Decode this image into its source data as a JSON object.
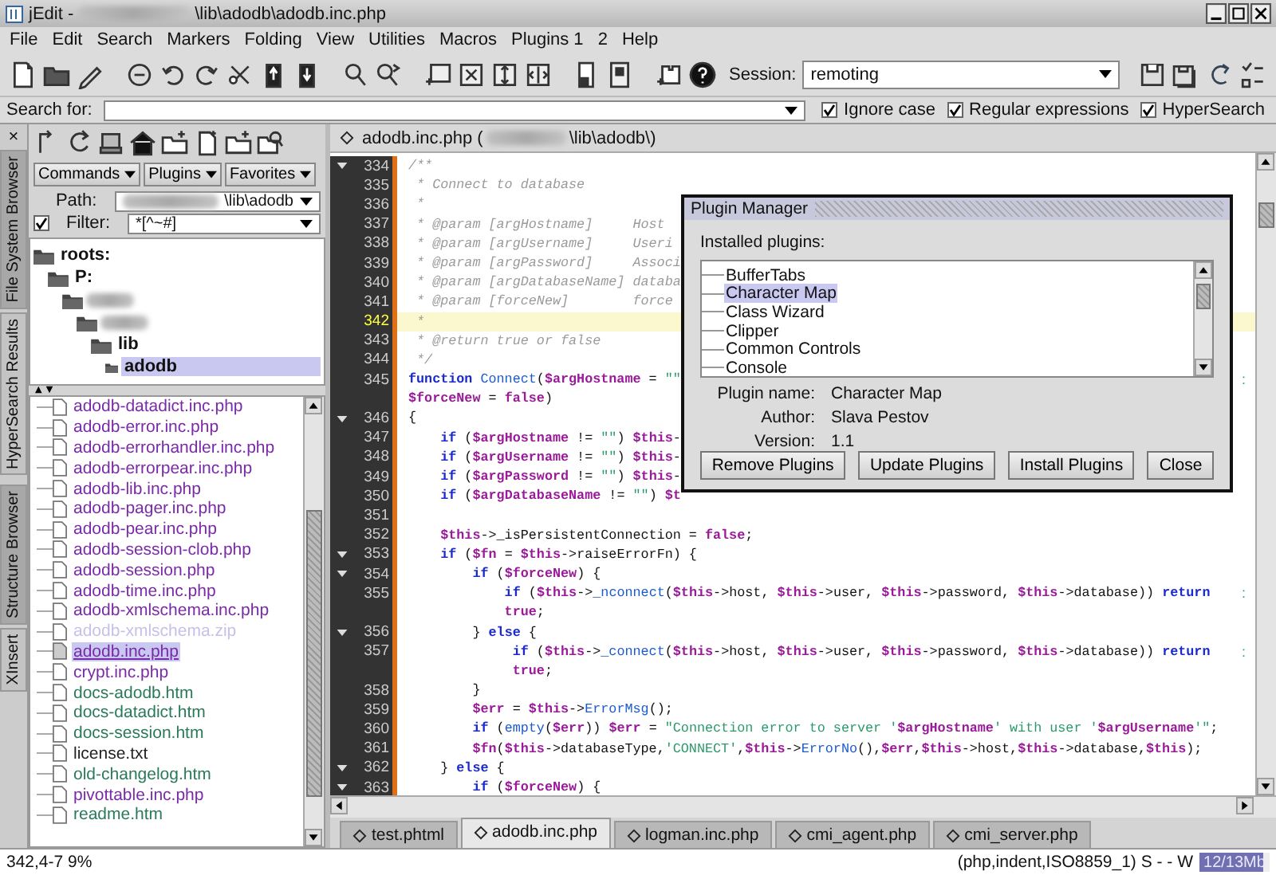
{
  "window": {
    "title_prefix": "jEdit -",
    "title_path": "\\lib\\adodb\\adodb.inc.php"
  },
  "menu": [
    "File",
    "Edit",
    "Search",
    "Markers",
    "Folding",
    "View",
    "Utilities",
    "Macros",
    "Plugins 1",
    "2",
    "Help"
  ],
  "session": {
    "label": "Session:",
    "value": "remoting"
  },
  "search_bar": {
    "label": "Search for:",
    "options": [
      {
        "label": "Ignore case",
        "checked": true
      },
      {
        "label": "Regular expressions",
        "checked": true
      },
      {
        "label": "HyperSearch",
        "checked": true
      }
    ]
  },
  "dock": {
    "close": "×",
    "tabs_top": [
      {
        "label": "File System Browser",
        "selected": true
      },
      {
        "label": "HyperSearch Results",
        "selected": false
      }
    ],
    "tabs_bottom": [
      {
        "label": "Structure Browser",
        "selected": true
      },
      {
        "label": "XInsert",
        "selected": false
      }
    ]
  },
  "browser": {
    "buttons": [
      "Commands",
      "Plugins",
      "Favorites"
    ],
    "path": {
      "label": "Path:",
      "value": "\\lib\\adodb"
    },
    "filter": {
      "label": "Filter:",
      "checked": true,
      "value": "*[^~#]"
    },
    "tree": [
      {
        "label": "roots:",
        "selected": false,
        "children": [
          {
            "label": "P:",
            "selected": false,
            "children": [
              {
                "redacted": true,
                "selected": false,
                "children": [
                  {
                    "redacted": true,
                    "selected": false,
                    "children": [
                      {
                        "label": "lib",
                        "selected": false,
                        "children": [
                          {
                            "label": "adodb",
                            "selected": true
                          }
                        ]
                      }
                    ]
                  }
                ]
              }
            ]
          }
        ]
      }
    ],
    "files": [
      {
        "name": "adodb-datadict.inc.php",
        "color": "#7a2aa8",
        "selected": false
      },
      {
        "name": "adodb-error.inc.php",
        "color": "#7a2aa8",
        "selected": false
      },
      {
        "name": "adodb-errorhandler.inc.php",
        "color": "#7a2aa8",
        "selected": false
      },
      {
        "name": "adodb-errorpear.inc.php",
        "color": "#7a2aa8",
        "selected": false
      },
      {
        "name": "adodb-lib.inc.php",
        "color": "#7a2aa8",
        "selected": false
      },
      {
        "name": "adodb-pager.inc.php",
        "color": "#7a2aa8",
        "selected": false
      },
      {
        "name": "adodb-pear.inc.php",
        "color": "#7a2aa8",
        "selected": false
      },
      {
        "name": "adodb-session-clob.php",
        "color": "#7a2aa8",
        "selected": false
      },
      {
        "name": "adodb-session.php",
        "color": "#7a2aa8",
        "selected": false
      },
      {
        "name": "adodb-time.inc.php",
        "color": "#7a2aa8",
        "selected": false
      },
      {
        "name": "adodb-xmlschema.inc.php",
        "color": "#7a2aa8",
        "selected": false
      },
      {
        "name": "adodb-xmlschema.zip",
        "color": "#c8c0e8",
        "selected": false
      },
      {
        "name": "adodb.inc.php",
        "color": "#7a2aa8",
        "selected": true
      },
      {
        "name": "crypt.inc.php",
        "color": "#7a2aa8",
        "selected": false
      },
      {
        "name": "docs-adodb.htm",
        "color": "#2a7a5a",
        "selected": false
      },
      {
        "name": "docs-datadict.htm",
        "color": "#2a7a5a",
        "selected": false
      },
      {
        "name": "docs-session.htm",
        "color": "#2a7a5a",
        "selected": false
      },
      {
        "name": "license.txt",
        "color": "#222222",
        "selected": false
      },
      {
        "name": "old-changelog.htm",
        "color": "#2a7a5a",
        "selected": false
      },
      {
        "name": "pivottable.inc.php",
        "color": "#7a2aa8",
        "selected": false
      },
      {
        "name": "readme.htm",
        "color": "#2a7a5a",
        "selected": false
      }
    ]
  },
  "editor": {
    "header_file": "adodb.inc.php (",
    "header_path": "\\lib\\adodb\\)",
    "lines": [
      {
        "number": "334",
        "fold": true,
        "current": false,
        "segments": [
          {
            "kind": "com",
            "text": "/**"
          }
        ]
      },
      {
        "number": "335",
        "fold": false,
        "current": false,
        "segments": [
          {
            "kind": "com",
            "text": " * Connect to database"
          }
        ]
      },
      {
        "number": "336",
        "fold": false,
        "current": false,
        "segments": [
          {
            "kind": "com",
            "text": " *"
          }
        ]
      },
      {
        "number": "337",
        "fold": false,
        "current": false,
        "segments": [
          {
            "kind": "com",
            "text": " * @param [argHostname]     Host"
          }
        ]
      },
      {
        "number": "338",
        "fold": false,
        "current": false,
        "segments": [
          {
            "kind": "com",
            "text": " * @param [argUsername]     Useri"
          }
        ]
      },
      {
        "number": "339",
        "fold": false,
        "current": false,
        "segments": [
          {
            "kind": "com",
            "text": " * @param [argPassword]     Associ"
          }
        ]
      },
      {
        "number": "340",
        "fold": false,
        "current": false,
        "segments": [
          {
            "kind": "com",
            "text": " * @param [argDatabaseName] databa"
          }
        ]
      },
      {
        "number": "341",
        "fold": false,
        "current": false,
        "segments": [
          {
            "kind": "com",
            "text": " * @param [forceNew]        force"
          }
        ]
      },
      {
        "number": "342",
        "fold": false,
        "current": true,
        "segments": [
          {
            "kind": "com",
            "text": " *"
          }
        ]
      },
      {
        "number": "343",
        "fold": false,
        "current": false,
        "segments": [
          {
            "kind": "com",
            "text": " * @return true or false"
          }
        ]
      },
      {
        "number": "344",
        "fold": false,
        "current": false,
        "segments": [
          {
            "kind": "com",
            "text": " */"
          }
        ]
      },
      {
        "number": "345",
        "fold": false,
        "current": false,
        "wrap_mark": ":",
        "segments": [
          {
            "kind": "kw",
            "text": "function "
          },
          {
            "kind": "fn",
            "text": "Connect"
          },
          {
            "kind": "txt",
            "text": "("
          },
          {
            "kind": "var",
            "text": "$argHostname"
          },
          {
            "kind": "txt",
            "text": " = "
          },
          {
            "kind": "str",
            "text": "\"\""
          }
        ]
      },
      {
        "fold": false,
        "current": false,
        "segments": [
          {
            "kind": "var",
            "text": "$forceNew"
          },
          {
            "kind": "txt",
            "text": " = "
          },
          {
            "kind": "lit",
            "text": "false"
          },
          {
            "kind": "txt",
            "text": ")"
          }
        ]
      },
      {
        "number": "346",
        "fold": true,
        "current": false,
        "segments": [
          {
            "kind": "txt",
            "text": "{"
          }
        ]
      },
      {
        "number": "347",
        "fold": false,
        "current": false,
        "segments": [
          {
            "kind": "kw",
            "text": "    if"
          },
          {
            "kind": "txt",
            "text": " ("
          },
          {
            "kind": "var",
            "text": "$argHostname"
          },
          {
            "kind": "txt",
            "text": " != "
          },
          {
            "kind": "str",
            "text": "\"\""
          },
          {
            "kind": "txt",
            "text": ") "
          },
          {
            "kind": "var",
            "text": "$this"
          },
          {
            "kind": "txt",
            "text": "-"
          }
        ]
      },
      {
        "number": "348",
        "fold": false,
        "current": false,
        "segments": [
          {
            "kind": "kw",
            "text": "    if"
          },
          {
            "kind": "txt",
            "text": " ("
          },
          {
            "kind": "var",
            "text": "$argUsername"
          },
          {
            "kind": "txt",
            "text": " != "
          },
          {
            "kind": "str",
            "text": "\"\""
          },
          {
            "kind": "txt",
            "text": ") "
          },
          {
            "kind": "var",
            "text": "$this"
          },
          {
            "kind": "txt",
            "text": "-"
          }
        ]
      },
      {
        "number": "349",
        "fold": false,
        "current": false,
        "segments": [
          {
            "kind": "kw",
            "text": "    if"
          },
          {
            "kind": "txt",
            "text": " ("
          },
          {
            "kind": "var",
            "text": "$argPassword"
          },
          {
            "kind": "txt",
            "text": " != "
          },
          {
            "kind": "str",
            "text": "\"\""
          },
          {
            "kind": "txt",
            "text": ") "
          },
          {
            "kind": "var",
            "text": "$this"
          },
          {
            "kind": "txt",
            "text": "-"
          }
        ]
      },
      {
        "number": "350",
        "fold": false,
        "current": false,
        "segments": [
          {
            "kind": "kw",
            "text": "    if"
          },
          {
            "kind": "txt",
            "text": " ("
          },
          {
            "kind": "var",
            "text": "$argDatabaseName"
          },
          {
            "kind": "txt",
            "text": " != "
          },
          {
            "kind": "str",
            "text": "\"\""
          },
          {
            "kind": "txt",
            "text": ") "
          },
          {
            "kind": "var",
            "text": "$t"
          }
        ]
      },
      {
        "number": "351",
        "fold": false,
        "current": false
      },
      {
        "number": "352",
        "fold": false,
        "current": false,
        "segments": [
          {
            "kind": "var",
            "text": "    $this"
          },
          {
            "kind": "txt",
            "text": "->_isPersistentConnection = "
          },
          {
            "kind": "lit",
            "text": "false"
          },
          {
            "kind": "txt",
            "text": ";"
          }
        ]
      },
      {
        "number": "353",
        "fold": true,
        "current": false,
        "segments": [
          {
            "kind": "kw",
            "text": "    if"
          },
          {
            "kind": "txt",
            "text": " ("
          },
          {
            "kind": "var",
            "text": "$fn"
          },
          {
            "kind": "txt",
            "text": " = "
          },
          {
            "kind": "var",
            "text": "$this"
          },
          {
            "kind": "txt",
            "text": "->raiseErrorFn) {"
          }
        ]
      },
      {
        "number": "354",
        "fold": true,
        "current": false,
        "segments": [
          {
            "kind": "kw",
            "text": "        if"
          },
          {
            "kind": "txt",
            "text": " ("
          },
          {
            "kind": "var",
            "text": "$forceNew"
          },
          {
            "kind": "txt",
            "text": ") {"
          }
        ]
      },
      {
        "number": "355",
        "fold": false,
        "current": false,
        "wrap_mark": ":",
        "segments": [
          {
            "kind": "kw",
            "text": "            if"
          },
          {
            "kind": "txt",
            "text": " ("
          },
          {
            "kind": "var",
            "text": "$this"
          },
          {
            "kind": "txt",
            "text": "->"
          },
          {
            "kind": "fn",
            "text": "_nconnect"
          },
          {
            "kind": "txt",
            "text": "("
          },
          {
            "kind": "var",
            "text": "$this"
          },
          {
            "kind": "txt",
            "text": "->host, "
          },
          {
            "kind": "var",
            "text": "$this"
          },
          {
            "kind": "txt",
            "text": "->user, "
          },
          {
            "kind": "var",
            "text": "$this"
          },
          {
            "kind": "txt",
            "text": "->password, "
          },
          {
            "kind": "var",
            "text": "$this"
          },
          {
            "kind": "txt",
            "text": "->database)) "
          },
          {
            "kind": "kw",
            "text": "return"
          }
        ]
      },
      {
        "fold": false,
        "current": false,
        "segments": [
          {
            "kind": "lit",
            "text": "            true"
          },
          {
            "kind": "txt",
            "text": ";"
          }
        ]
      },
      {
        "number": "356",
        "fold": true,
        "current": false,
        "segments": [
          {
            "kind": "txt",
            "text": "        } "
          },
          {
            "kind": "kw",
            "text": "else"
          },
          {
            "kind": "txt",
            "text": " {"
          }
        ]
      },
      {
        "number": "357",
        "fold": false,
        "current": false,
        "wrap_mark": ":",
        "segments": [
          {
            "kind": "kw",
            "text": "             if"
          },
          {
            "kind": "txt",
            "text": " ("
          },
          {
            "kind": "var",
            "text": "$this"
          },
          {
            "kind": "txt",
            "text": "->"
          },
          {
            "kind": "fn",
            "text": "_connect"
          },
          {
            "kind": "txt",
            "text": "("
          },
          {
            "kind": "var",
            "text": "$this"
          },
          {
            "kind": "txt",
            "text": "->host, "
          },
          {
            "kind": "var",
            "text": "$this"
          },
          {
            "kind": "txt",
            "text": "->user, "
          },
          {
            "kind": "var",
            "text": "$this"
          },
          {
            "kind": "txt",
            "text": "->password, "
          },
          {
            "kind": "var",
            "text": "$this"
          },
          {
            "kind": "txt",
            "text": "->database)) "
          },
          {
            "kind": "kw",
            "text": "return"
          }
        ]
      },
      {
        "fold": false,
        "current": false,
        "segments": [
          {
            "kind": "lit",
            "text": "             true"
          },
          {
            "kind": "txt",
            "text": ";"
          }
        ]
      },
      {
        "number": "358",
        "fold": false,
        "current": false,
        "segments": [
          {
            "kind": "txt",
            "text": "        }"
          }
        ]
      },
      {
        "number": "359",
        "fold": false,
        "current": false,
        "segments": [
          {
            "kind": "var",
            "text": "        $err"
          },
          {
            "kind": "txt",
            "text": " = "
          },
          {
            "kind": "var",
            "text": "$this"
          },
          {
            "kind": "txt",
            "text": "->"
          },
          {
            "kind": "fn",
            "text": "ErrorMsg"
          },
          {
            "kind": "txt",
            "text": "();"
          }
        ]
      },
      {
        "number": "360",
        "fold": false,
        "current": false,
        "segments": [
          {
            "kind": "kw",
            "text": "        if"
          },
          {
            "kind": "txt",
            "text": " ("
          },
          {
            "kind": "fn",
            "text": "empty"
          },
          {
            "kind": "txt",
            "text": "("
          },
          {
            "kind": "var",
            "text": "$err"
          },
          {
            "kind": "txt",
            "text": ")) "
          },
          {
            "kind": "var",
            "text": "$err"
          },
          {
            "kind": "txt",
            "text": " = "
          },
          {
            "kind": "str",
            "text": "\"Connection error to server '"
          },
          {
            "kind": "var",
            "text": "$argHostname"
          },
          {
            "kind": "str",
            "text": "' with user '"
          },
          {
            "kind": "var",
            "text": "$argUsername"
          },
          {
            "kind": "str",
            "text": "'\""
          },
          {
            "kind": "txt",
            "text": ";"
          }
        ]
      },
      {
        "number": "361",
        "fold": false,
        "current": false,
        "segments": [
          {
            "kind": "var",
            "text": "        $fn"
          },
          {
            "kind": "txt",
            "text": "("
          },
          {
            "kind": "var",
            "text": "$this"
          },
          {
            "kind": "txt",
            "text": "->databaseType,"
          },
          {
            "kind": "str",
            "text": "'CONNECT'"
          },
          {
            "kind": "txt",
            "text": ","
          },
          {
            "kind": "var",
            "text": "$this"
          },
          {
            "kind": "txt",
            "text": "->"
          },
          {
            "kind": "fn",
            "text": "ErrorNo"
          },
          {
            "kind": "txt",
            "text": "(),"
          },
          {
            "kind": "var",
            "text": "$err"
          },
          {
            "kind": "txt",
            "text": ","
          },
          {
            "kind": "var",
            "text": "$this"
          },
          {
            "kind": "txt",
            "text": "->host,"
          },
          {
            "kind": "var",
            "text": "$this"
          },
          {
            "kind": "txt",
            "text": "->database,"
          },
          {
            "kind": "var",
            "text": "$this"
          },
          {
            "kind": "txt",
            "text": ");"
          }
        ]
      },
      {
        "number": "362",
        "fold": true,
        "current": false,
        "segments": [
          {
            "kind": "txt",
            "text": "    } "
          },
          {
            "kind": "kw",
            "text": "else"
          },
          {
            "kind": "txt",
            "text": " {"
          }
        ]
      },
      {
        "number": "363",
        "fold": true,
        "current": false,
        "segments": [
          {
            "kind": "kw",
            "text": "        if"
          },
          {
            "kind": "txt",
            "text": " ("
          },
          {
            "kind": "var",
            "text": "$forceNew"
          },
          {
            "kind": "txt",
            "text": ") {"
          }
        ]
      }
    ]
  },
  "buffer_tabs": [
    {
      "label": "test.phtml",
      "selected": false
    },
    {
      "label": "adodb.inc.php",
      "selected": true
    },
    {
      "label": "logman.inc.php",
      "selected": false
    },
    {
      "label": "cmi_agent.php",
      "selected": false
    },
    {
      "label": "cmi_server.php",
      "selected": false
    }
  ],
  "status": {
    "position": "342,4-7 9%",
    "mode": "(php,indent,ISO8859_1) S - - W",
    "memory": {
      "text": "12/13Mb",
      "level": 0.92
    }
  },
  "dialog": {
    "title": "Plugin Manager",
    "list_label": "Installed plugins:",
    "plugins": [
      {
        "name": "BufferTabs",
        "selected": false
      },
      {
        "name": "Character Map",
        "selected": true
      },
      {
        "name": "Class Wizard",
        "selected": false
      },
      {
        "name": "Clipper",
        "selected": false
      },
      {
        "name": "Common Controls",
        "selected": false
      },
      {
        "name": "Console",
        "selected": false
      }
    ],
    "details": [
      {
        "label": "Plugin name:",
        "value": "Character Map"
      },
      {
        "label": "Author:",
        "value": "Slava Pestov"
      },
      {
        "label": "Version:",
        "value": "1.1"
      }
    ],
    "buttons": [
      "Remove Plugins",
      "Update Plugins",
      "Install Plugins",
      "Close"
    ]
  }
}
